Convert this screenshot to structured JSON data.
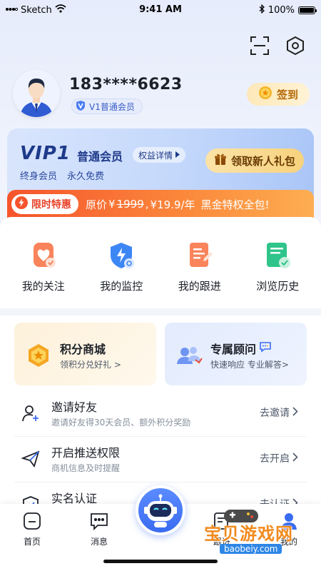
{
  "status_bar": {
    "carrier": "Sketch",
    "time": "9:41 AM",
    "battery": "100%"
  },
  "header": {
    "scan_icon": "scan-icon",
    "settings_icon": "hexagon-settings-icon"
  },
  "profile": {
    "phone": "183****6623",
    "member_level": "V1普通会员",
    "checkin_label": "签到"
  },
  "vip": {
    "logo": "VIP1",
    "level": "普通会员",
    "rights_label": "权益详情",
    "sub_items": [
      "终身会员",
      "永久免费"
    ],
    "gift_label": "领取新人礼包"
  },
  "promo": {
    "tag": "限时特惠",
    "prefix": "原价",
    "currency": "¥",
    "original": "1999",
    "sep": ",",
    "price": "¥19.9/年",
    "tail": "黑金特权全包!"
  },
  "quick_actions": [
    {
      "label": "我的关注",
      "icon": "heart-follow-icon"
    },
    {
      "label": "我的监控",
      "icon": "shield-monitor-icon"
    },
    {
      "label": "我的跟进",
      "icon": "document-followup-icon"
    },
    {
      "label": "浏览历史",
      "icon": "history-icon"
    }
  ],
  "feature_cards": [
    {
      "title": "积分商城",
      "subtitle": "领积分兑好礼 >",
      "icon": "points-coin-icon"
    },
    {
      "title": "专属顾问",
      "subtitle": "快速响应  专业解答>",
      "icon": "advisor-icon"
    }
  ],
  "list": [
    {
      "title": "邀请好友",
      "subtitle": "邀请好友得30天会员、额外积分奖励",
      "action": "去邀请",
      "icon": "add-user-icon"
    },
    {
      "title": "开启推送权限",
      "subtitle": "商机信息及时提醒",
      "action": "去开启",
      "icon": "paper-plane-icon"
    },
    {
      "title": "实名认证",
      "subtitle": "",
      "action": "去认证",
      "icon": "shield-check-icon"
    }
  ],
  "tabs": [
    {
      "label": "首页",
      "icon": "home-icon"
    },
    {
      "label": "消息",
      "icon": "message-icon"
    },
    {
      "label": "跟进",
      "icon": "followup-icon"
    },
    {
      "label": "我的",
      "icon": "me-icon"
    }
  ],
  "watermark": {
    "text": "宝贝游戏网",
    "url": "baobeiy.com"
  },
  "colors": {
    "accent": "#3a6cf0",
    "promo": "#f6542c",
    "gold": "#f7d27e"
  }
}
